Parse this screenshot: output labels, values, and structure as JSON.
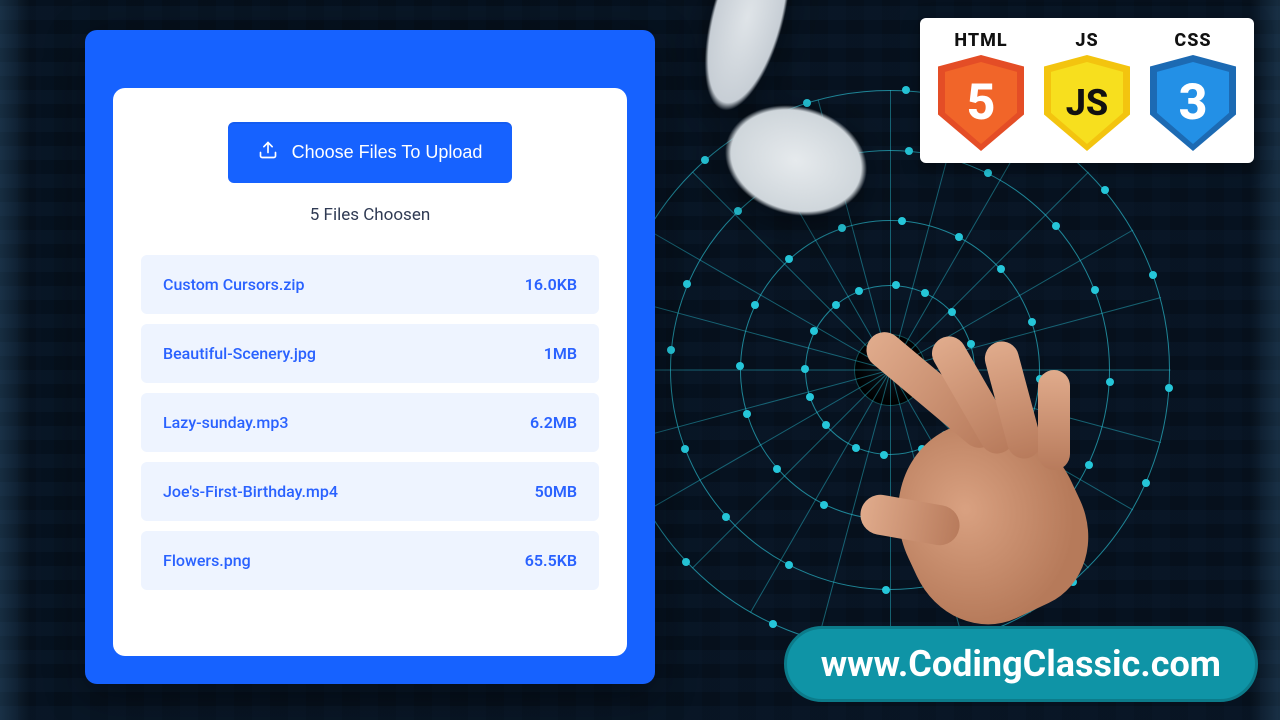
{
  "upload": {
    "button_label": "Choose Files To Upload",
    "count_label": "5 Files Choosen",
    "files": [
      {
        "name": "Custom Cursors.zip",
        "size": "16.0KB"
      },
      {
        "name": "Beautiful-Scenery.jpg",
        "size": "1MB"
      },
      {
        "name": "Lazy-sunday.mp3",
        "size": "6.2MB"
      },
      {
        "name": "Joe's-First-Birthday.mp4",
        "size": "50MB"
      },
      {
        "name": "Flowers.png",
        "size": "65.5KB"
      }
    ]
  },
  "tech": {
    "html_label": "HTML",
    "html_glyph": "5",
    "js_label": "JS",
    "js_glyph": "JS",
    "css_label": "CSS",
    "css_glyph": "3"
  },
  "site_url": "www.CodingClassic.com",
  "colors": {
    "card_blue": "#1662ff",
    "row_bg": "#eef4ff",
    "link_blue": "#2a62ff",
    "pill_teal": "#0f94a6",
    "circuit": "#25c6d9"
  }
}
